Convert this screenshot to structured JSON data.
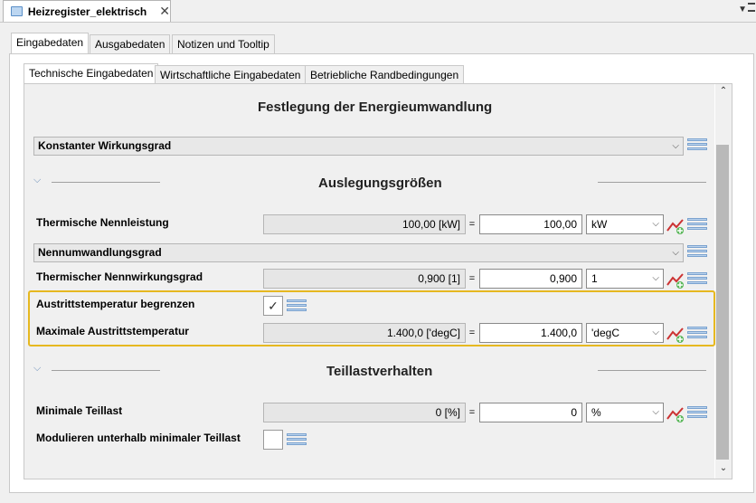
{
  "editor": {
    "tab_title": "Heizregister_elektrisch",
    "close": "✕",
    "view_menu": "▼"
  },
  "outer_tabs": [
    "Eingabedaten",
    "Ausgabedaten",
    "Notizen und Tooltip"
  ],
  "inner_tabs": [
    "Technische Eingabedaten",
    "Wirtschaftliche Eingabedaten",
    "Betriebliche Randbedingungen"
  ],
  "sections": {
    "energy": {
      "title": "Festlegung der Energieumwandlung",
      "combo": "Konstanter Wirkungsgrad"
    },
    "design": {
      "title": "Auslegungsgrößen",
      "combo": "Nennumwandlungsgrad"
    },
    "partload": {
      "title": "Teillastverhalten"
    }
  },
  "fields": {
    "nennleistung": {
      "label": "Thermische Nennleistung",
      "computed": "100,00 [kW]",
      "value": "100,00",
      "unit": "kW"
    },
    "nennwirkungsgrad": {
      "label": "Thermischer Nennwirkungsgrad",
      "computed": "0,900 [1]",
      "value": "0,900",
      "unit": "1"
    },
    "begrenzen": {
      "label": "Austrittstemperatur begrenzen",
      "checked": "✓"
    },
    "max_temp": {
      "label": "Maximale Austrittstemperatur",
      "computed": "1.400,0 ['degC]",
      "value": "1.400,0",
      "unit": "'degC"
    },
    "min_teillast": {
      "label": "Minimale Teillast",
      "computed": "0 [%]",
      "value": "0",
      "unit": "%"
    },
    "modulieren": {
      "label": "Modulieren unterhalb minimaler Teillast",
      "checked": ""
    }
  },
  "symbols": {
    "equals": "=",
    "dropdown": "⌵",
    "chevron": "⌵",
    "scroll_up": "⌃",
    "scroll_down": "⌄"
  },
  "colors": {
    "highlight": "#e6b820",
    "menu_icon": "#bcd4ee"
  }
}
